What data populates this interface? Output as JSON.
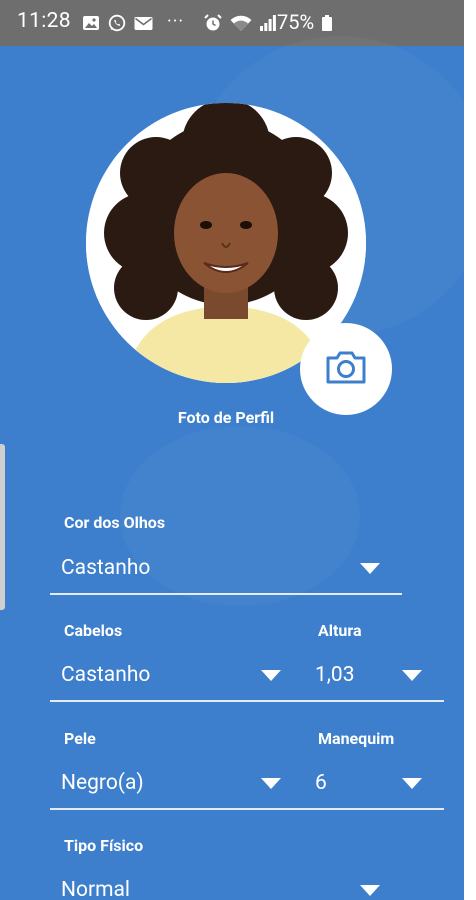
{
  "status_bar": {
    "time": "11:28",
    "more_indicator": "···",
    "battery_percent": "75%",
    "icons": [
      "gallery-icon",
      "whatsapp-icon",
      "mail-icon",
      "alarm-icon",
      "wifi-icon",
      "signal-icon",
      "battery-icon"
    ]
  },
  "profile": {
    "photo_label": "Foto de Perfil",
    "camera_icon": "camera-icon"
  },
  "form": {
    "eye_color": {
      "label": "Cor dos Olhos",
      "value": "Castanho"
    },
    "hair": {
      "label": "Cabelos",
      "value": "Castanho"
    },
    "height": {
      "label": "Altura",
      "value": "1,03"
    },
    "skin": {
      "label": "Pele",
      "value": "Negro(a)"
    },
    "mannequin": {
      "label": "Manequim",
      "value": "6"
    },
    "body_type": {
      "label": "Tipo Físico",
      "value": "Normal"
    }
  },
  "colors": {
    "background": "#3d7fcc",
    "status_bar": "#6e6e6e",
    "text": "#ffffff"
  }
}
